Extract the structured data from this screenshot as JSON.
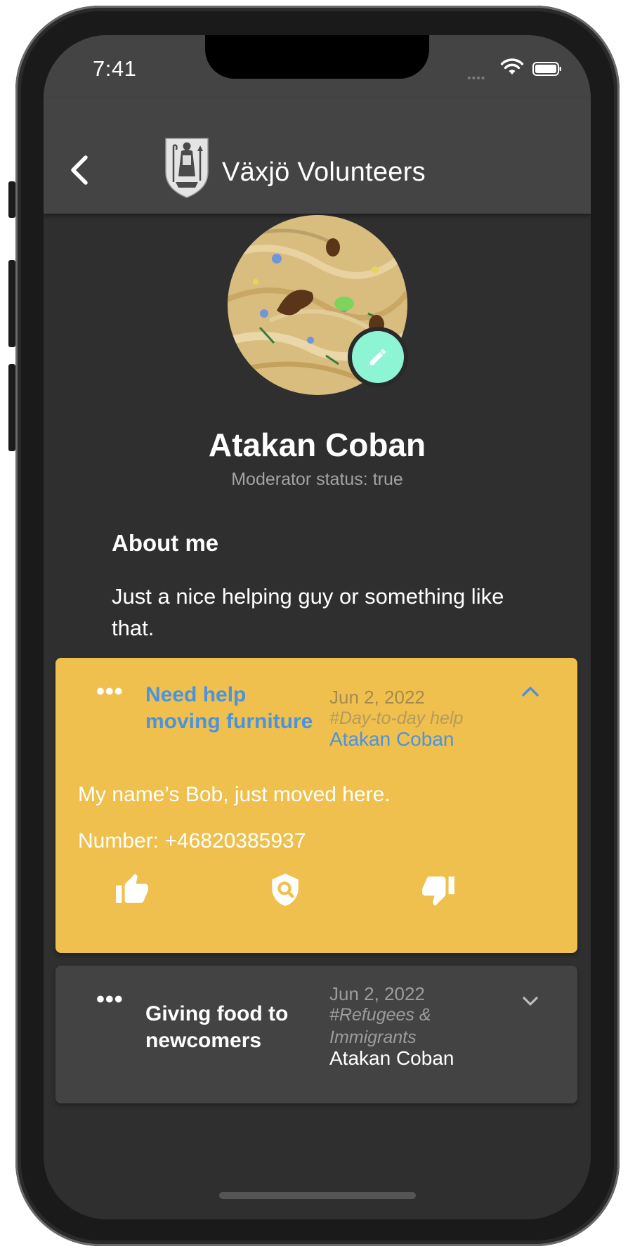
{
  "status_bar": {
    "time": "7:41"
  },
  "app_bar": {
    "title": "Växjö Volunteers"
  },
  "profile": {
    "name": "Atakan Coban",
    "moderator_status": "Moderator status: true",
    "about_title": "About me",
    "about_text": "Just a nice helping guy or something like that."
  },
  "posts": [
    {
      "title": "Need help moving furniture",
      "date": "Jun 2, 2022",
      "tag": "#Day-to-day help",
      "author": "Atakan Coban",
      "body_line_1": "My name’s Bob, just moved here.",
      "body_line_2": "Number: +46820385937",
      "expanded": true,
      "accent_color": "#efc04d",
      "title_color": "#4a93e0"
    },
    {
      "title": "Giving food to newcomers",
      "date": "Jun 2, 2022",
      "tag": "#Refugees & Immigrants",
      "author": "Atakan Coban",
      "expanded": false,
      "background_color": "#434343"
    }
  ],
  "colors": {
    "screen_bg": "#2f2f2f",
    "app_bar_bg": "#444444",
    "edit_fab": "#8ef5d4"
  }
}
